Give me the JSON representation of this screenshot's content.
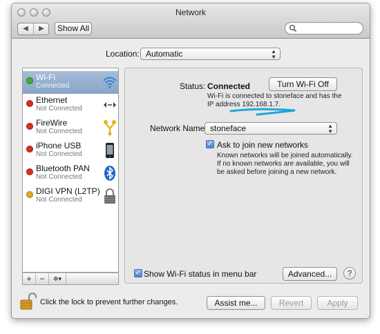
{
  "window": {
    "title": "Network"
  },
  "toolbar": {
    "back_label": "◀",
    "forward_label": "▶",
    "show_all_label": "Show All",
    "search_placeholder": ""
  },
  "location": {
    "label": "Location:",
    "value": "Automatic"
  },
  "services": [
    {
      "name": "Wi-Fi",
      "status": "Connected",
      "dot_color": "#3fae2a",
      "icon": "wifi-icon",
      "selected": true
    },
    {
      "name": "Ethernet",
      "status": "Not Connected",
      "dot_color": "#d62f22",
      "icon": "ethernet-icon"
    },
    {
      "name": "FireWire",
      "status": "Not Connected",
      "dot_color": "#d62f22",
      "icon": "firewire-icon"
    },
    {
      "name": "iPhone USB",
      "status": "Not Connected",
      "dot_color": "#d62f22",
      "icon": "iphone-icon"
    },
    {
      "name": "Bluetooth PAN",
      "status": "Not Connected",
      "dot_color": "#d62f22",
      "icon": "bluetooth-icon"
    },
    {
      "name": "DIGI VPN (L2TP)",
      "status": "Not Connected",
      "dot_color": "#e6a81c",
      "icon": "vpn-lock-icon"
    }
  ],
  "sidebar_controls": {
    "add_label": "+",
    "remove_label": "−",
    "action_label": "✲▾"
  },
  "detail": {
    "status_label": "Status:",
    "status_value": "Connected",
    "turn_off_label": "Turn Wi-Fi Off",
    "status_description_line1": "Wi-Fi is connected to stoneface and has the",
    "status_description_line2": "IP address 192.168.1.7.",
    "network_name_label": "Network Name:",
    "network_name_value": "stoneface",
    "ask_join_label": "Ask to join new networks",
    "ask_join_desc_line1": "Known networks will be joined automatically.",
    "ask_join_desc_line2": "If no known networks are available, you will",
    "ask_join_desc_line3": "be asked before joining a new network.",
    "show_status_label": "Show Wi-Fi status in menu bar",
    "advanced_label": "Advanced...",
    "help_label": "?"
  },
  "footer": {
    "lock_text": "Click the lock to prevent further changes.",
    "assist_label": "Assist me...",
    "revert_label": "Revert",
    "apply_label": "Apply"
  },
  "colors": {
    "selection": "#8ea8cb",
    "highlight": "#1ea6d6",
    "connected_dot": "#3fae2a",
    "disconnected_dot": "#d62f22",
    "vpn_dot": "#e6a81c"
  }
}
